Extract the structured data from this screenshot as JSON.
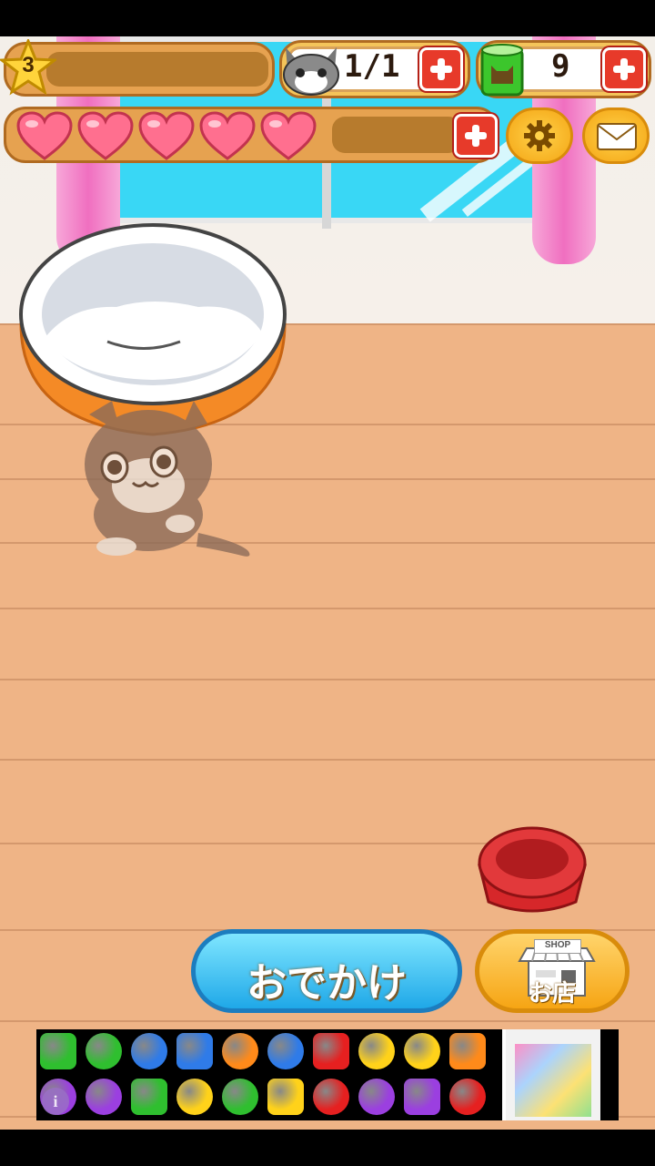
{
  "hud": {
    "level": "3",
    "cats": "1/1",
    "cans": "9",
    "hearts_count": 5,
    "hearts_total": 7
  },
  "buttons": {
    "outing": "おでかけ",
    "shop_sign": "SHOP",
    "shop_label": "お店"
  },
  "ad": {
    "info_glyph": "i"
  },
  "colors": {
    "heart": "#ff6f8f",
    "accent_orange": "#f4a514",
    "accent_blue": "#1fa8e8",
    "plus_red": "#e73a2a"
  }
}
